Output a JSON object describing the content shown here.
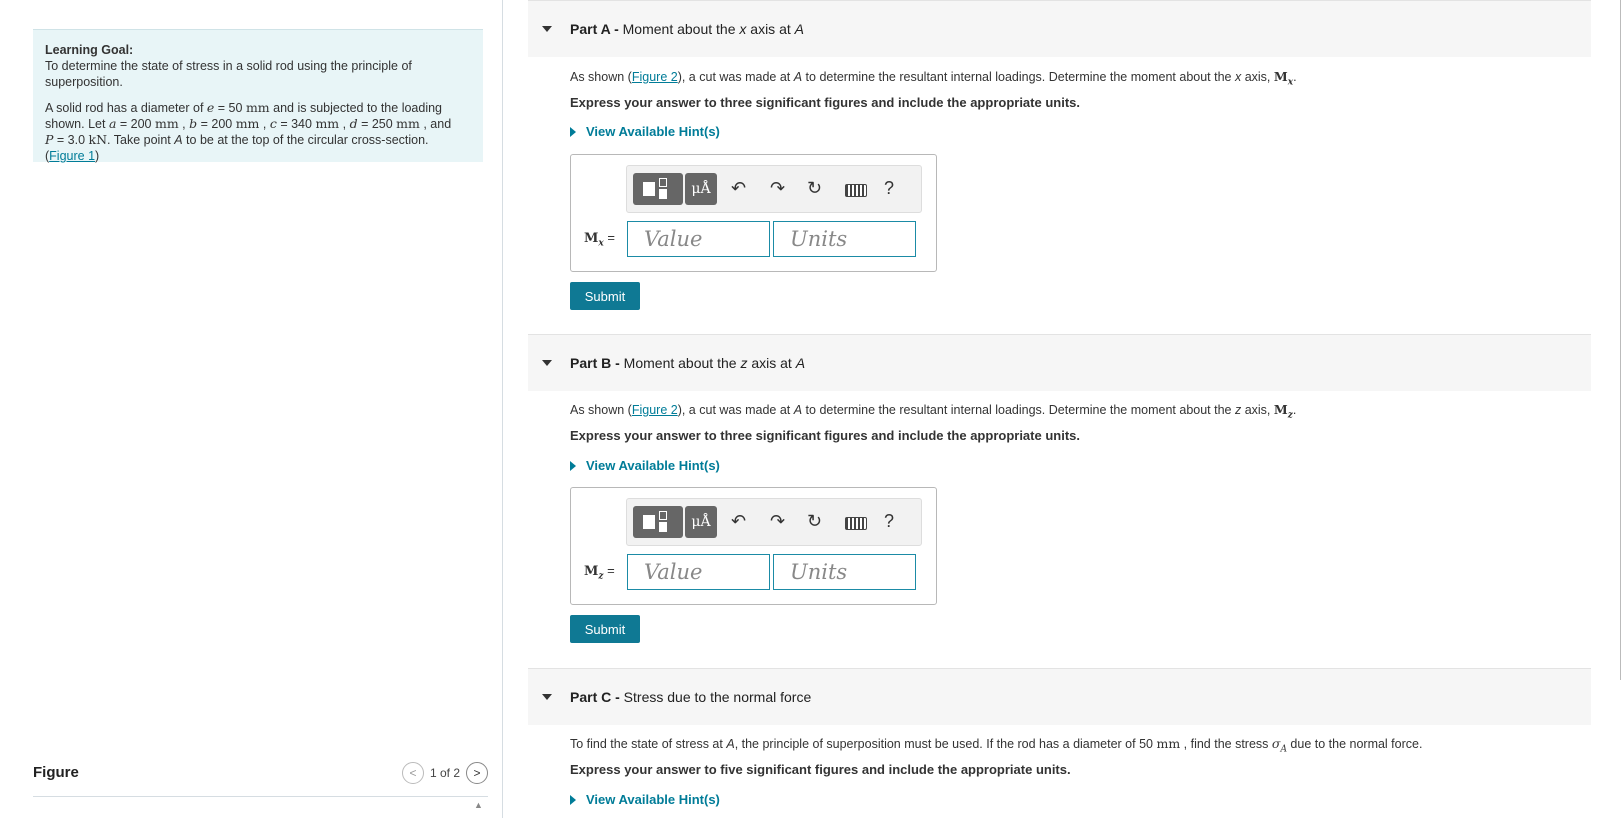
{
  "learning_goal": {
    "title": "Learning Goal:",
    "goal_text": "To determine the state of stress in a solid rod using the principle of superposition.",
    "s1": "A solid rod has a diameter of ",
    "var_e": "e",
    "v_e": " = 50 ",
    "unit_mm": "mm",
    "s2": " and is subjected to the loading shown. Let ",
    "var_a": "a",
    "v_a": " = 200 ",
    "var_b": "b",
    "v_b": " = 200 ",
    "var_c": "c",
    "v_c": " = 340 ",
    "var_d": "d",
    "v_d": " = 250 ",
    "and": " , and",
    "var_P": "P",
    "v_P": " = 3.0 ",
    "unit_kN": "kN",
    "s3": ". Take point ",
    "pt_A": "A",
    "s4": " to be at the top of the circular cross-section.",
    "fig_open": "(",
    "fig_link": "Figure 1",
    "fig_close": ")",
    "comma": " , "
  },
  "figure_panel": {
    "label": "Figure",
    "page": "1 of 2",
    "prev": "<",
    "next": ">",
    "scroll": "▲"
  },
  "part_a": {
    "label": "Part A -",
    "title_pre": " Moment about the ",
    "axis": "x",
    "title_mid": " axis at ",
    "point": "A",
    "q_pre": "As shown (",
    "fig_link": "Figure 2",
    "q_mid": "), a cut was made at ",
    "q_pt": "A",
    "q_mid2": " to determine the resultant internal loadings. Determine the moment about the ",
    "q_axis": "x",
    "q_post": " axis, ",
    "q_sym": "M",
    "q_sub": "x",
    "q_end": ".",
    "instruction": "Express your answer to three significant figures and include the appropriate units.",
    "hint": "View Available Hint(s)",
    "field_sym": "M",
    "field_sub": "x",
    "field_eq": " =",
    "value_placeholder": "Value",
    "units_placeholder": "Units",
    "submit": "Submit"
  },
  "part_b": {
    "label": "Part B -",
    "title_pre": " Moment about the ",
    "axis": "z",
    "title_mid": " axis at ",
    "point": "A",
    "q_pre": "As shown (",
    "fig_link": "Figure 2",
    "q_mid": "),  a cut was made at ",
    "q_pt": "A",
    "q_mid2": " to determine the resultant internal loadings. Determine the moment about the ",
    "q_axis": "z",
    "q_post": " axis, ",
    "q_sym": "M",
    "q_sub": "z",
    "q_end": ".",
    "instruction": "Express your answer to three significant figures and include the appropriate units.",
    "hint": "View Available Hint(s)",
    "field_sym": "M",
    "field_sub": "z",
    "field_eq": " =",
    "value_placeholder": "Value",
    "units_placeholder": "Units",
    "submit": "Submit"
  },
  "part_c": {
    "label": "Part C -",
    "title": " Stress due to the normal force",
    "q_pre": "To find the state of stress at ",
    "q_pt": "A",
    "q_mid": ", the principle of superposition must be used. If the rod has a diameter of 50 ",
    "q_unit": "mm",
    "q_mid2": " , find the stress ",
    "q_sym": "σ",
    "q_sub": "A",
    "q_end": " due to the normal force.",
    "instruction": "Express your answer to five significant figures and include the appropriate units.",
    "hint": "View Available Hint(s)"
  },
  "toolbar": {
    "units_btn": "μÅ",
    "undo": "↶",
    "redo": "↷",
    "reset": "↻",
    "help": "?"
  }
}
